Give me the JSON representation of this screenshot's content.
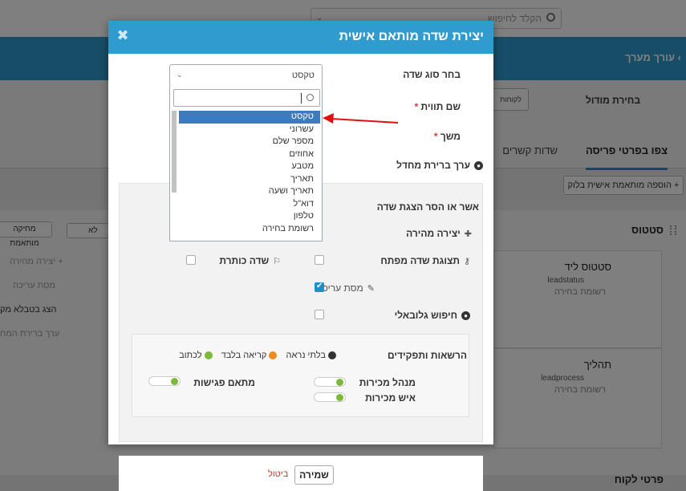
{
  "background": {
    "search_placeholder": "הקלד לחיפוש",
    "breadcrumb": "עורך מערך",
    "module_label": "בחירת מודול",
    "module_button": "לקוחות",
    "tabs": [
      "צפו בפרטי פריסה",
      "שדות קשרים"
    ],
    "add_block": "הוספה מותאמת אישית בלוק",
    "status_title": "סטטוס",
    "toggle_no": "לא",
    "delete_custom": "מחיקה מותאמת",
    "cards": [
      {
        "name": "סטטוס ליד",
        "code": "leadstatus",
        "type": "רשומת בחירה"
      },
      {
        "name": "תהליך",
        "code": "leadprocess",
        "type": "רשומת בחירה"
      }
    ],
    "left_items": [
      "יצירה מהירה",
      "מסת עריכה",
      "הצג בטבלא מק",
      "ערך ברירת המח"
    ],
    "customer_details": "פרטי לקוח"
  },
  "modal": {
    "title": "יצירת שדה מותאם אישית",
    "field_type_label": "בחר סוג שדה",
    "label_name": "שם תווית",
    "length_label": "משך",
    "default_value_label": "ערך ברירת מחדל",
    "approve_label": "אשר או הסר הצגת שדה",
    "quick_create": "יצירה מהירה",
    "key_field": "תצוגת שדה מפתח",
    "title_field": "שדה כותרת",
    "mass_edit": "מסת עריכה",
    "global_search": "חיפוש גלובאלי",
    "permissions_title": "הרשאות ותפקידים",
    "legend": {
      "hidden": "בלתי נראה",
      "read_only": "קריאה בלבד",
      "write": "לכתוב"
    },
    "roles": [
      {
        "name": "מנהל מכירות"
      },
      {
        "name": "איש מכירות"
      },
      {
        "name": "מתאם פגישות"
      }
    ],
    "select_value": "טקסט",
    "dropdown_options": [
      "טקסט",
      "עשרוני",
      "מספר שלם",
      "אחוזים",
      "מטבע",
      "תאריך",
      "תאריך ושעה",
      "דוא\"ל",
      "טלפון",
      "רשומת בחירה"
    ],
    "selected_option_index": 0
  },
  "footer": {
    "save": "שמירה",
    "cancel": "ביטול"
  },
  "colors": {
    "header": "#2f9bcf",
    "selected": "#3a7cbf",
    "arrow": "#e01010",
    "hidden_dot": "#333333",
    "read_only_dot": "#f08a1c",
    "write_dot": "#7cb83a"
  }
}
